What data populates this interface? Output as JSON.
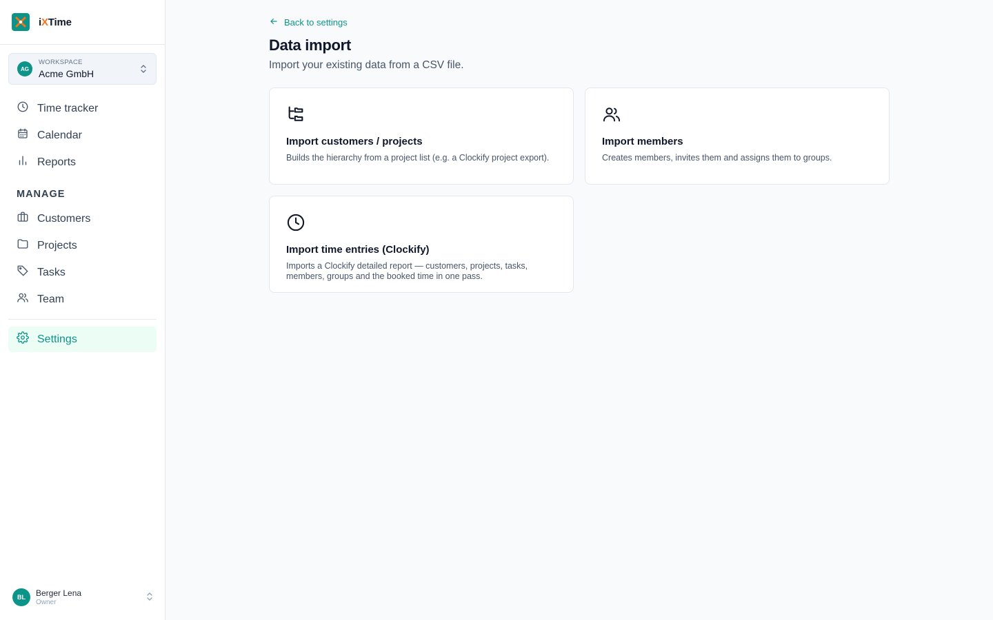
{
  "app": {
    "name_prefix": "i",
    "name_x": "X",
    "name_suffix": "Time",
    "accent": "#0d9488",
    "logo_accent": "#f97316"
  },
  "workspace": {
    "badge": "AG",
    "label": "WORKSPACE",
    "name": "Acme GmbH"
  },
  "sidebar": {
    "primary": [
      {
        "label": "Time tracker",
        "icon": "clock-icon"
      },
      {
        "label": "Calendar",
        "icon": "calendar-icon"
      },
      {
        "label": "Reports",
        "icon": "bar-chart-icon"
      }
    ],
    "section_title": "MANAGE",
    "manage": [
      {
        "label": "Customers",
        "icon": "briefcase-icon"
      },
      {
        "label": "Projects",
        "icon": "folder-icon"
      },
      {
        "label": "Tasks",
        "icon": "tag-icon"
      },
      {
        "label": "Team",
        "icon": "users-icon"
      }
    ],
    "settings": {
      "label": "Settings",
      "icon": "gear-icon",
      "active": true
    }
  },
  "user": {
    "initials": "BL",
    "name": "Berger Lena",
    "role": "Owner"
  },
  "main": {
    "back_label": "Back to settings",
    "title": "Data import",
    "subtitle": "Import your existing data from a CSV file.",
    "cards": [
      {
        "icon": "folder-tree-icon",
        "title": "Import customers / projects",
        "description": "Builds the hierarchy from a project list (e.g. a Clockify project export)."
      },
      {
        "icon": "users-icon",
        "title": "Import members",
        "description": "Creates members, invites them and assigns them to groups."
      },
      {
        "icon": "clock-icon",
        "title": "Import time entries (Clockify)",
        "description": "Imports a Clockify detailed report — customers, projects, tasks, members, groups and the booked time in one pass."
      }
    ]
  }
}
